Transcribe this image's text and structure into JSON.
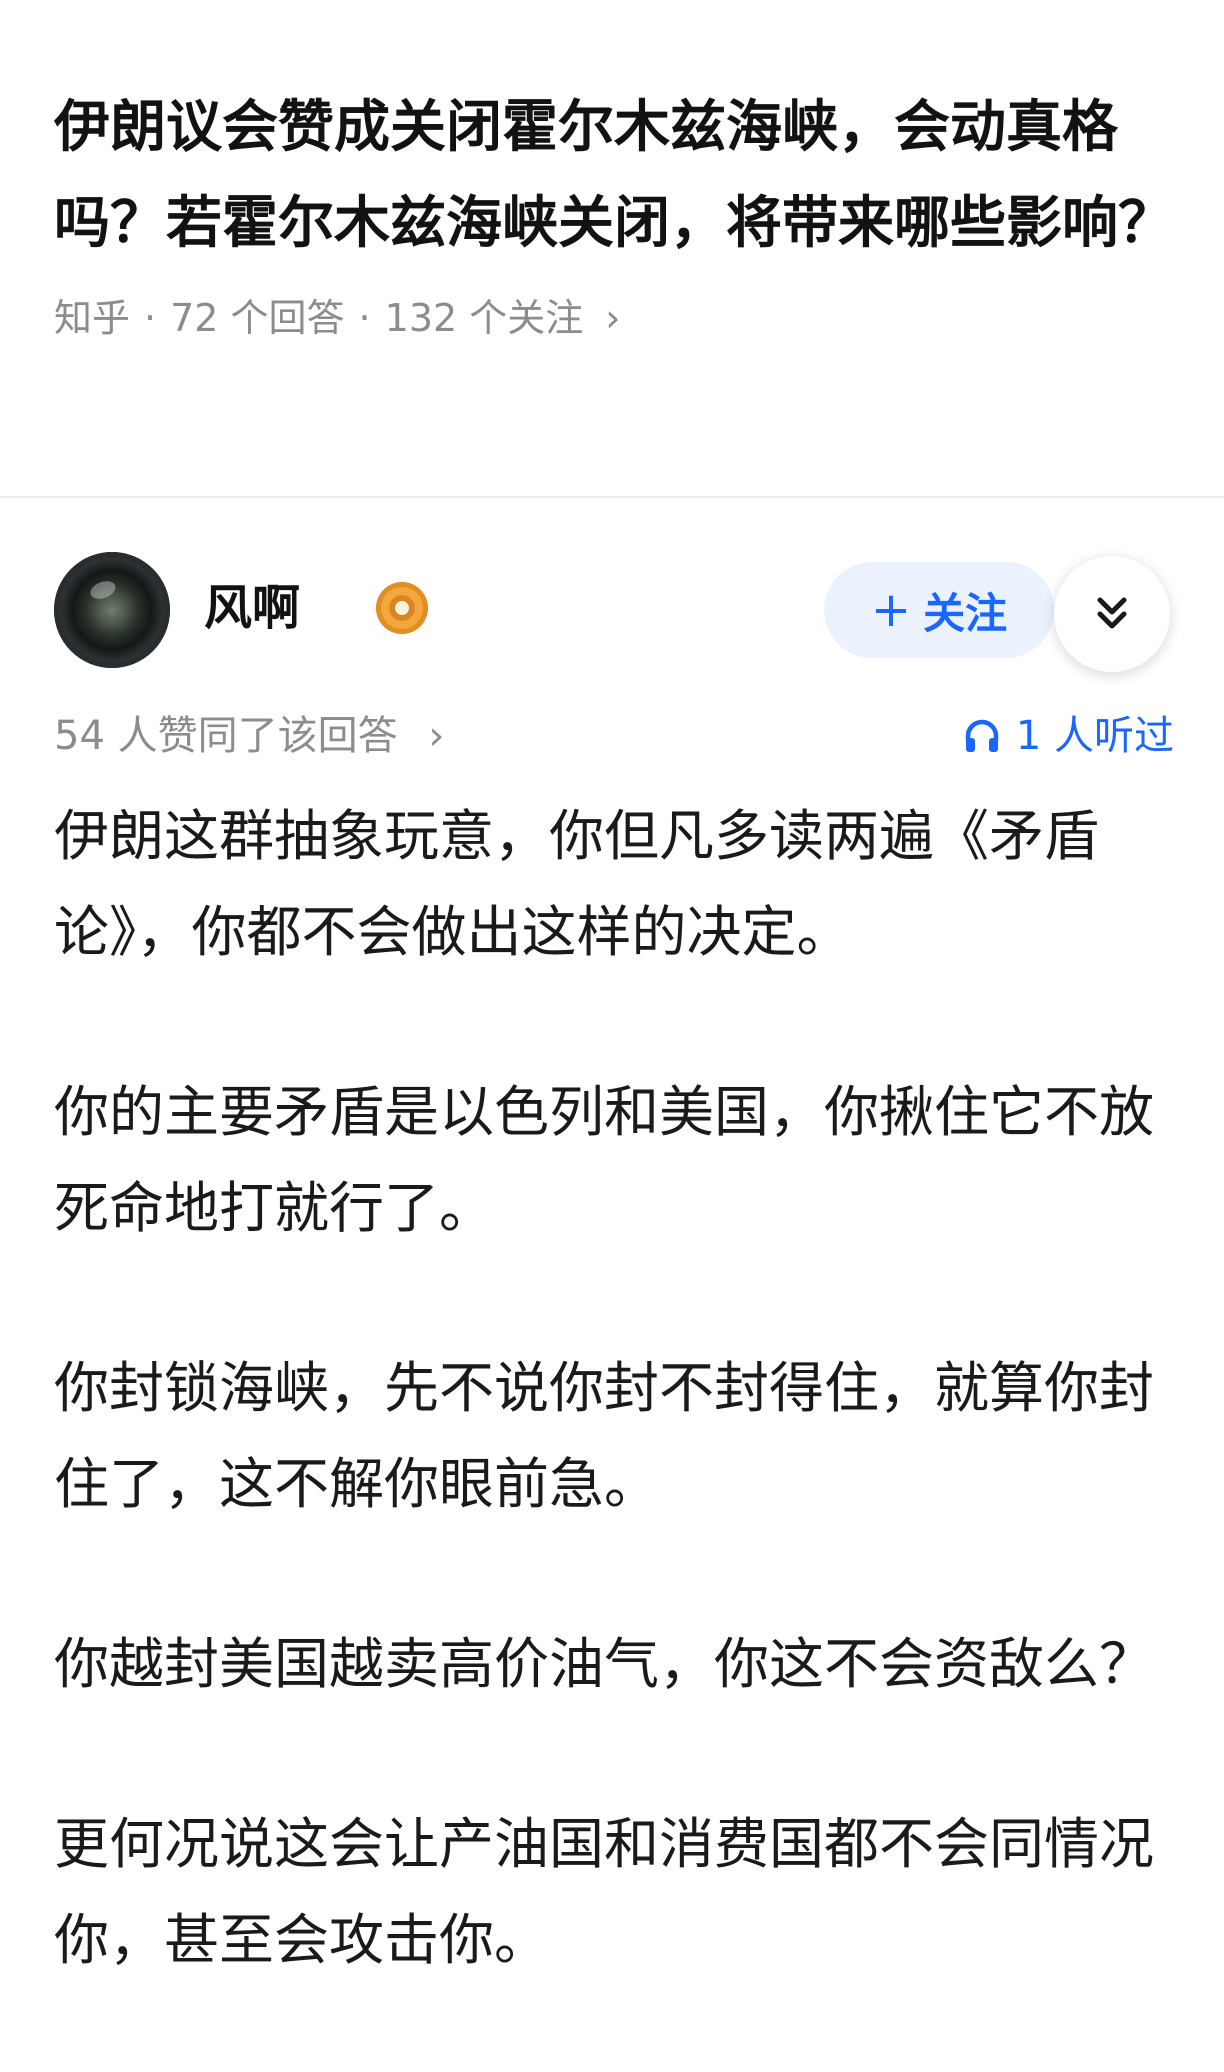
{
  "question": {
    "title": "伊朗议会赞成关闭霍尔木兹海峡，会动真格吗？若霍尔木兹海峡关闭，将带来哪些影响？",
    "source": "知乎",
    "answers_count": "72 个回答",
    "followers_count": "132 个关注",
    "separator": "·",
    "chevron": "›"
  },
  "author": {
    "name": "风啊",
    "avatar_icon": "camera-lens-avatar",
    "badge_icon": "certified-badge-icon"
  },
  "actions": {
    "follow_plus": "+",
    "follow_label": "关注",
    "more_icon": "double-chevron-down-icon"
  },
  "stats": {
    "votes": "54 人赞同了该回答",
    "votes_chevron": "›",
    "listened": "1 人听过",
    "listened_icon": "headphones-icon"
  },
  "answer": {
    "paragraphs": [
      "伊朗这群抽象玩意，你但凡多读两遍《矛盾论》，你都不会做出这样的决定。",
      "你的主要矛盾是以色列和美国，你揪住它不放死命地打就行了。",
      "你封锁海峡，先不说你封不封得住，就算你封住了，这不解你眼前急。",
      "你越封美国越卖高价油气，你这不会资敌么？",
      "更何况说这会让产油国和消费国都不会同情况你，甚至会攻击你。"
    ]
  },
  "colors": {
    "accent": "#1a66ff",
    "follow_bg": "#ebf2fd",
    "meta_gray": "#8c8c8c",
    "text": "#1a1a1a",
    "badge": "#f4a63c"
  }
}
